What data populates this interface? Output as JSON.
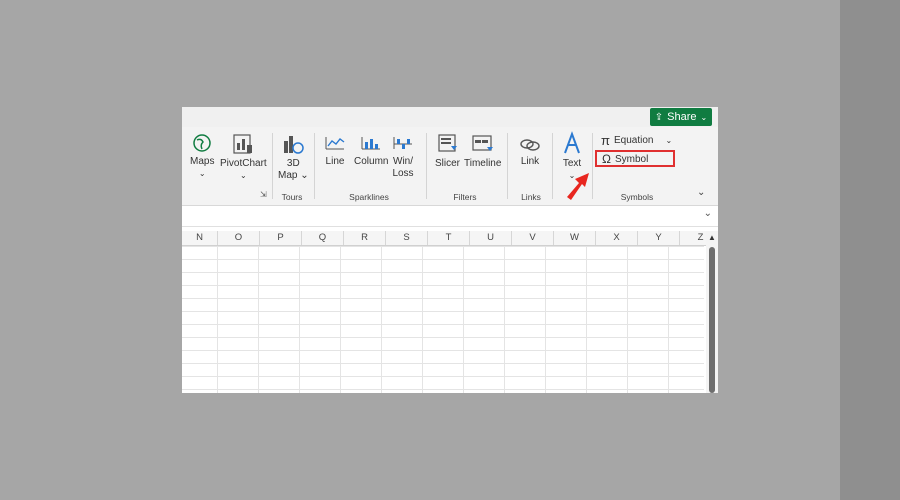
{
  "share": {
    "label": "Share",
    "icon": "share-icon"
  },
  "ribbon": {
    "buttons": {
      "maps": "Maps",
      "pivotchart": "PivotChart",
      "map3d_line1": "3D",
      "map3d_line2": "Map",
      "line": "Line",
      "column": "Column",
      "winloss_line1": "Win/",
      "winloss_line2": "Loss",
      "slicer": "Slicer",
      "timeline": "Timeline",
      "link": "Link",
      "text": "Text",
      "equation": "Equation",
      "symbol": "Symbol"
    },
    "groups": {
      "tours": "Tours",
      "sparklines": "Sparklines",
      "filters": "Filters",
      "links": "Links",
      "symbols": "Symbols"
    }
  },
  "columns": [
    "N",
    "O",
    "P",
    "Q",
    "R",
    "S",
    "T",
    "U",
    "V",
    "W",
    "X",
    "Y",
    "Z"
  ],
  "colors": {
    "accent": "#107c41",
    "highlight": "#e03030"
  }
}
